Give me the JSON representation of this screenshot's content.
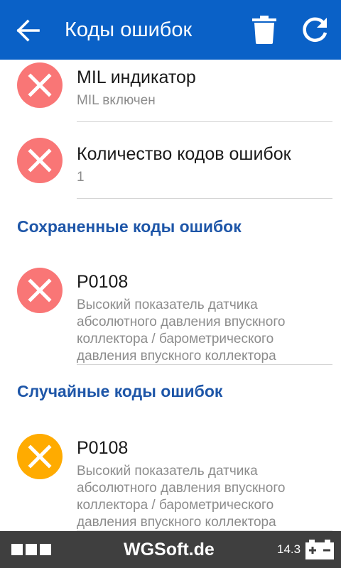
{
  "appbar": {
    "title": "Коды ошибок",
    "back_icon": "arrow-back-icon",
    "delete_icon": "trash-icon",
    "refresh_icon": "refresh-icon",
    "color": "#0a61c7"
  },
  "status_rows": [
    {
      "title": "MIL индикатор",
      "subtitle": "MIL включен",
      "status": "error",
      "icon": "error-x-icon"
    },
    {
      "title": "Количество кодов ошибок",
      "subtitle": "1",
      "status": "error",
      "icon": "error-x-icon"
    }
  ],
  "stored_section": {
    "header": "Сохраненные коды ошибок",
    "items": [
      {
        "code": "P0108",
        "description": "Высокий показатель датчика абсолютного давления впускного коллектора / барометрического давления впускного коллектора",
        "status": "error",
        "icon": "error-x-icon"
      }
    ]
  },
  "pending_section": {
    "header": "Случайные коды ошибок",
    "items": [
      {
        "code": "P0108",
        "description": "Высокий показатель датчика абсолютного давления впускного коллектора / барометрического давления впускного коллектора",
        "status": "warning",
        "icon": "warning-x-icon"
      }
    ]
  },
  "colors": {
    "error": "#f97676",
    "warning": "#ffab00",
    "section_header": "#1e56a8"
  },
  "bottombar": {
    "brand": "WGSoft.de",
    "voltage": "14.3",
    "battery_icon": "car-battery-icon",
    "indicator_icon": "connection-squares-icon"
  }
}
